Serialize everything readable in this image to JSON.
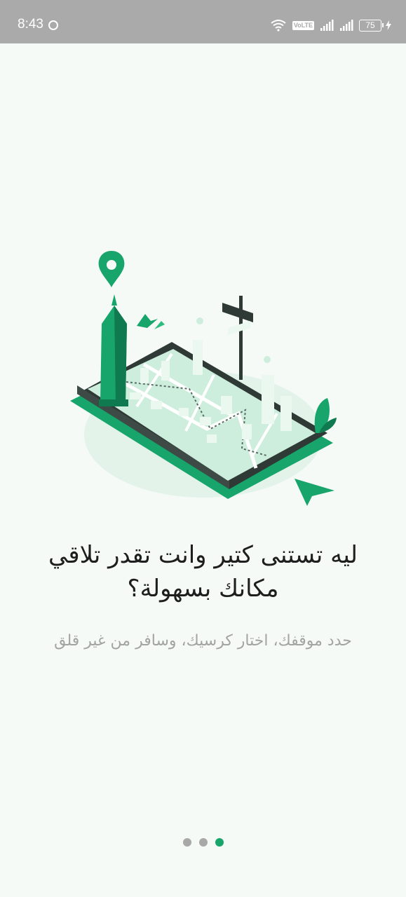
{
  "status_bar": {
    "time": "8:43",
    "volte": "VoLTE",
    "battery": "75"
  },
  "onboarding": {
    "title_line1": "ليه تستنى كتير وانت تقدر تلاقي",
    "title_line2": "مكانك بسهولة؟",
    "subtitle": "حدد موقفك، اختار كرسيك، وسافر من غير قلق"
  },
  "pager": {
    "total": 3,
    "active_index": 2
  },
  "colors": {
    "accent": "#18a56c",
    "dark_green": "#0f7a4f",
    "light_green": "#bfe8d2",
    "status_bar": "#a9aaa9",
    "background": "#f5faf7"
  },
  "icons": [
    "wifi-icon",
    "signal-icon",
    "battery-icon",
    "map-pin-icon",
    "cursor-arrow-icon"
  ]
}
